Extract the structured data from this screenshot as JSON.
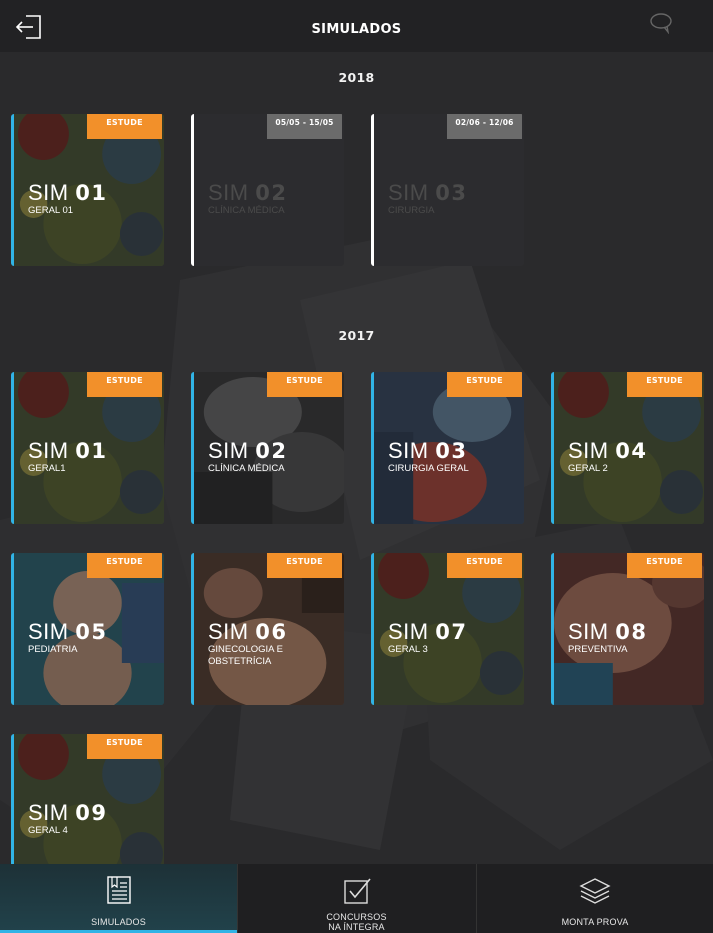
{
  "header": {
    "title": "SIMULADOS",
    "back_icon": "exit-arrow-icon",
    "chat_icon": "speech-bubble-icon"
  },
  "sections": [
    {
      "year": "2018",
      "cards": [
        {
          "prefix": "SIM",
          "number": "01",
          "subtitle": "GERAL 01",
          "tag": "ESTUDE",
          "locked": false,
          "art": "virus"
        },
        {
          "prefix": "SIM",
          "number": "02",
          "subtitle": "CLÍNICA MÉDICA",
          "tag": "05/05 - 15/05",
          "locked": true,
          "art": "none"
        },
        {
          "prefix": "SIM",
          "number": "03",
          "subtitle": "CIRURGIA",
          "tag": "02/06 - 12/06",
          "locked": true,
          "art": "none"
        }
      ]
    },
    {
      "year": "2017",
      "cards": [
        {
          "prefix": "SIM",
          "number": "01",
          "subtitle": "GERAL1",
          "tag": "ESTUDE",
          "locked": false,
          "art": "virus"
        },
        {
          "prefix": "SIM",
          "number": "02",
          "subtitle": "CLÍNICA MÉDICA",
          "tag": "ESTUDE",
          "locked": false,
          "art": "scan"
        },
        {
          "prefix": "SIM",
          "number": "03",
          "subtitle": "CIRURGIA GERAL",
          "tag": "ESTUDE",
          "locked": false,
          "art": "surgery"
        },
        {
          "prefix": "SIM",
          "number": "04",
          "subtitle": "GERAL 2",
          "tag": "ESTUDE",
          "locked": false,
          "art": "virus"
        },
        {
          "prefix": "SIM",
          "number": "05",
          "subtitle": "PEDIATRIA",
          "tag": "ESTUDE",
          "locked": false,
          "art": "baby"
        },
        {
          "prefix": "SIM",
          "number": "06",
          "subtitle": "GINECOLOGIA E OBSTETRÍCIA",
          "tag": "ESTUDE",
          "locked": false,
          "art": "pregnant"
        },
        {
          "prefix": "SIM",
          "number": "07",
          "subtitle": "GERAL 3",
          "tag": "ESTUDE",
          "locked": false,
          "art": "virus"
        },
        {
          "prefix": "SIM",
          "number": "08",
          "subtitle": "PREVENTIVA",
          "tag": "ESTUDE",
          "locked": false,
          "art": "vaccine"
        },
        {
          "prefix": "SIM",
          "number": "09",
          "subtitle": "GERAL 4",
          "tag": "ESTUDE",
          "locked": false,
          "art": "virus"
        }
      ]
    }
  ],
  "tabs": [
    {
      "label_1": "SIMULADOS",
      "label_2": "",
      "icon": "document-list-icon",
      "active": true
    },
    {
      "label_1": "CONCURSOS",
      "label_2": "NA ÍNTEGRA",
      "icon": "checkbox-icon",
      "active": false
    },
    {
      "label_1": "MONTA PROVA",
      "label_2": "",
      "icon": "layers-icon",
      "active": false
    }
  ],
  "colors": {
    "accent": "#31b4e6",
    "tag": "#f2902a",
    "date_tag": "#6b6b6b",
    "background": "#2b2b2d"
  }
}
